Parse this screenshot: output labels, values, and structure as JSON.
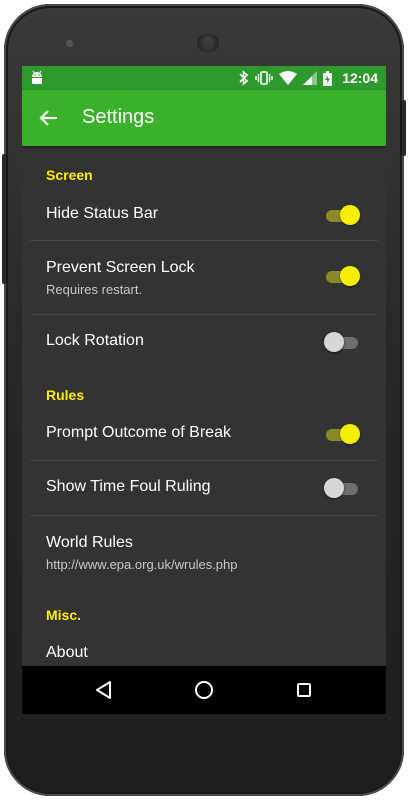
{
  "status_bar": {
    "time": "12:04",
    "icons": [
      "android-icon",
      "bluetooth-icon",
      "vibrate-icon",
      "wifi-icon",
      "signal-icon",
      "battery-charging-icon"
    ]
  },
  "app_bar": {
    "title": "Settings",
    "back_icon": "arrow-left-icon"
  },
  "sections": [
    {
      "category": "Screen",
      "items": [
        {
          "title": "Hide Status Bar",
          "summary": "",
          "switch": true
        },
        {
          "title": "Prevent Screen Lock",
          "summary": "Requires restart.",
          "switch": true
        },
        {
          "title": "Lock Rotation",
          "summary": "",
          "switch": false
        }
      ]
    },
    {
      "category": "Rules",
      "items": [
        {
          "title": "Prompt Outcome of Break",
          "summary": "",
          "switch": true
        },
        {
          "title": "Show Time Foul Ruling",
          "summary": "",
          "switch": false
        },
        {
          "title": "World Rules",
          "summary": "http://www.epa.org.uk/wrules.php"
        }
      ]
    },
    {
      "category": "Misc.",
      "items": [
        {
          "title": "About",
          "summary": ""
        }
      ]
    }
  ],
  "nav_bar": {
    "buttons": [
      "back-triangle-icon",
      "home-circle-icon",
      "recents-square-icon"
    ]
  },
  "colors": {
    "status_bar": "#2e9a2e",
    "app_bar": "#39b12a",
    "background": "#333333",
    "category_text": "#ffee00",
    "switch_on_thumb": "#f5ee00",
    "switch_on_track": "#8b8a26",
    "switch_off_thumb": "#d7d7d7",
    "switch_off_track": "#6e6e6e"
  }
}
